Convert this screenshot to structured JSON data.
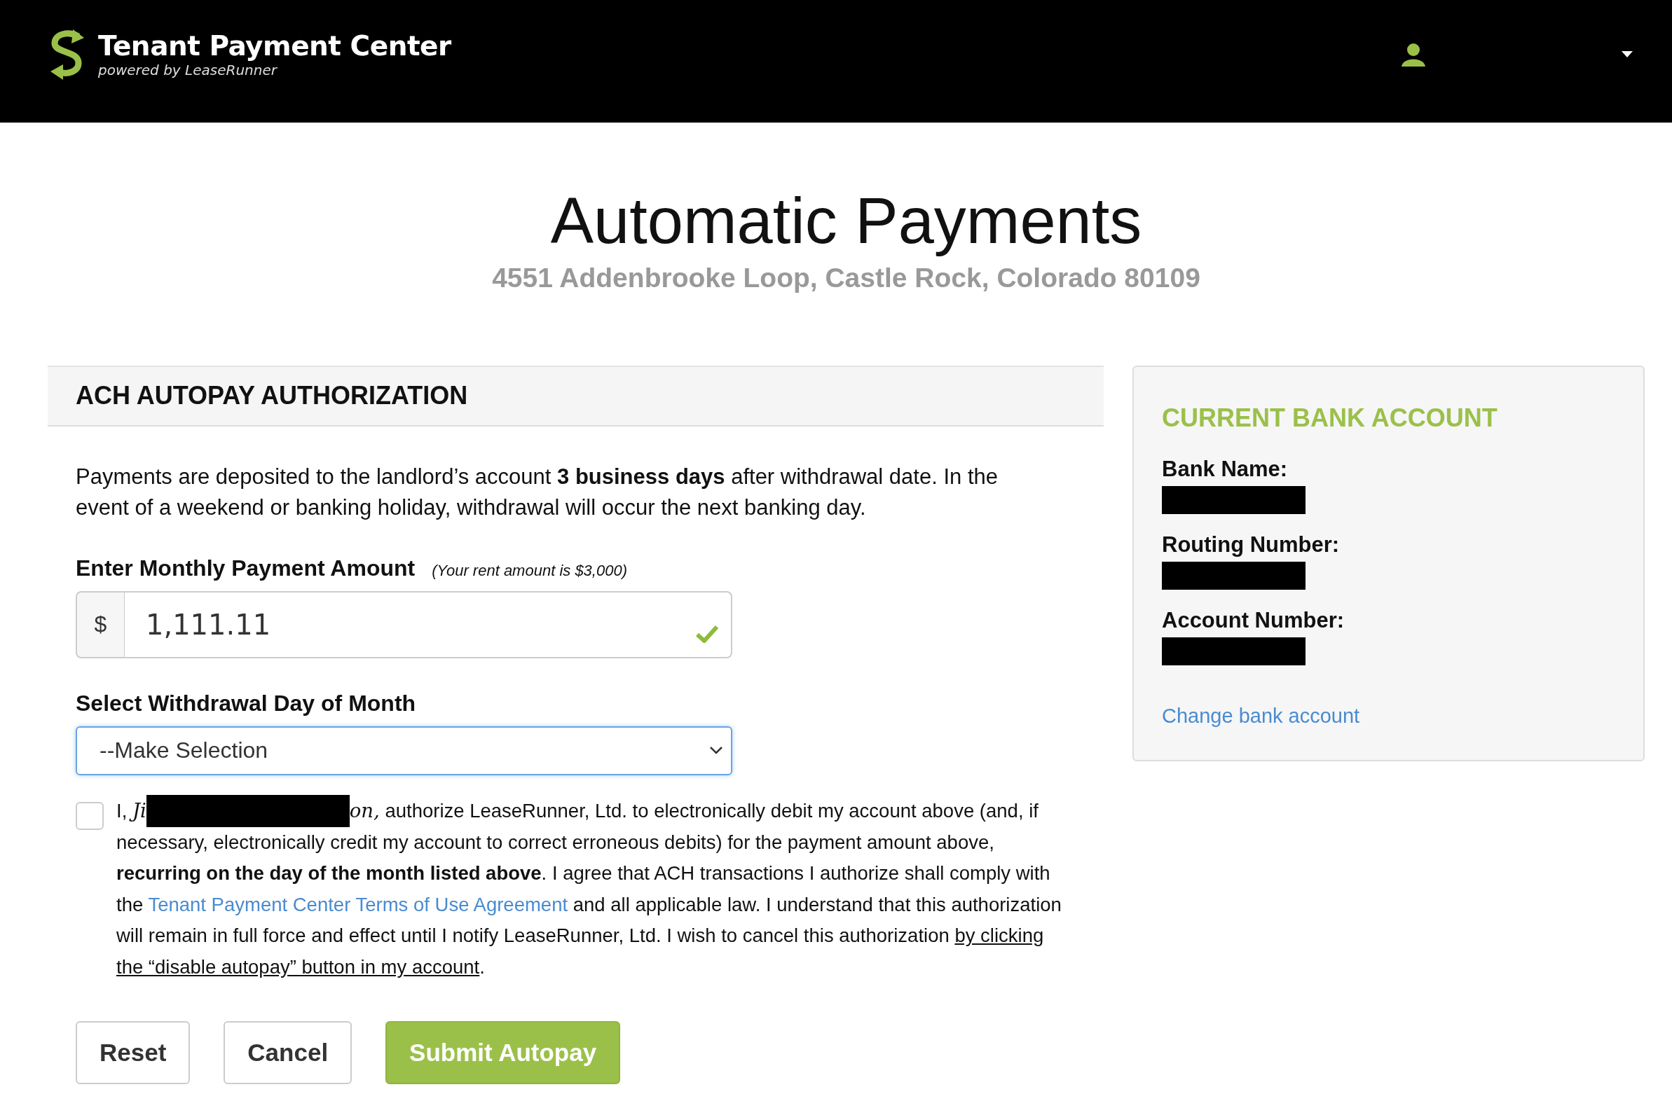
{
  "header": {
    "title": "Tenant Payment Center",
    "subtitle": "powered by LeaseRunner"
  },
  "page_title": "Automatic Payments",
  "address": "4551 Addenbrooke Loop, Castle Rock, Colorado 80109",
  "authorization": {
    "title": "ACH AUTOPAY AUTHORIZATION",
    "intro": "Payments are deposited to the landlord’s account **3 business days** after withdrawal date. In the event of a weekend or banking holiday, withdrawal will occur the next banking day.",
    "amount": {
      "label": "Enter Monthly Payment Amount",
      "hint": "(Your rent amount is $3,000)",
      "currency": "$",
      "value": "1,111.11",
      "valid": true
    },
    "withdrawal_day": {
      "label": "Select Withdrawal Day of Month",
      "value": "--Make Selection",
      "focused": true
    },
    "consent": {
      "checked": false,
      "prefix": "I,",
      "signature_start": "Ji",
      "signature_end": "on,",
      "text_1": "authorize LeaseRunner, Ltd. to electronically debit my account above (and, if necessary, electronically credit my account to correct erroneous debits) for the payment amount above, **recurring on the day of the month listed above**. I agree that ACH transactions I authorize shall comply with the",
      "terms_link": "Tenant Payment Center Terms of Use Agreement",
      "text_2": "and all applicable law. I understand that this authorization will remain in full force and effect until I notify LeaseRunner, Ltd. I wish to cancel this authorization",
      "disable_link": [
        "by clicking",
        "the “disable autopay” button in my account"
      ],
      "end": "."
    },
    "buttons": [
      {
        "label": "Reset",
        "kind": "default"
      },
      {
        "label": "Cancel",
        "kind": "default"
      },
      {
        "label": "Submit Autopay",
        "kind": "primary"
      }
    ]
  },
  "bank_account": {
    "title": "CURRENT BANK ACCOUNT",
    "fields": [
      {
        "label": "Bank Name:"
      },
      {
        "label": "Routing Number:"
      },
      {
        "label": "Account Number:"
      }
    ],
    "link": "Change bank account"
  }
}
